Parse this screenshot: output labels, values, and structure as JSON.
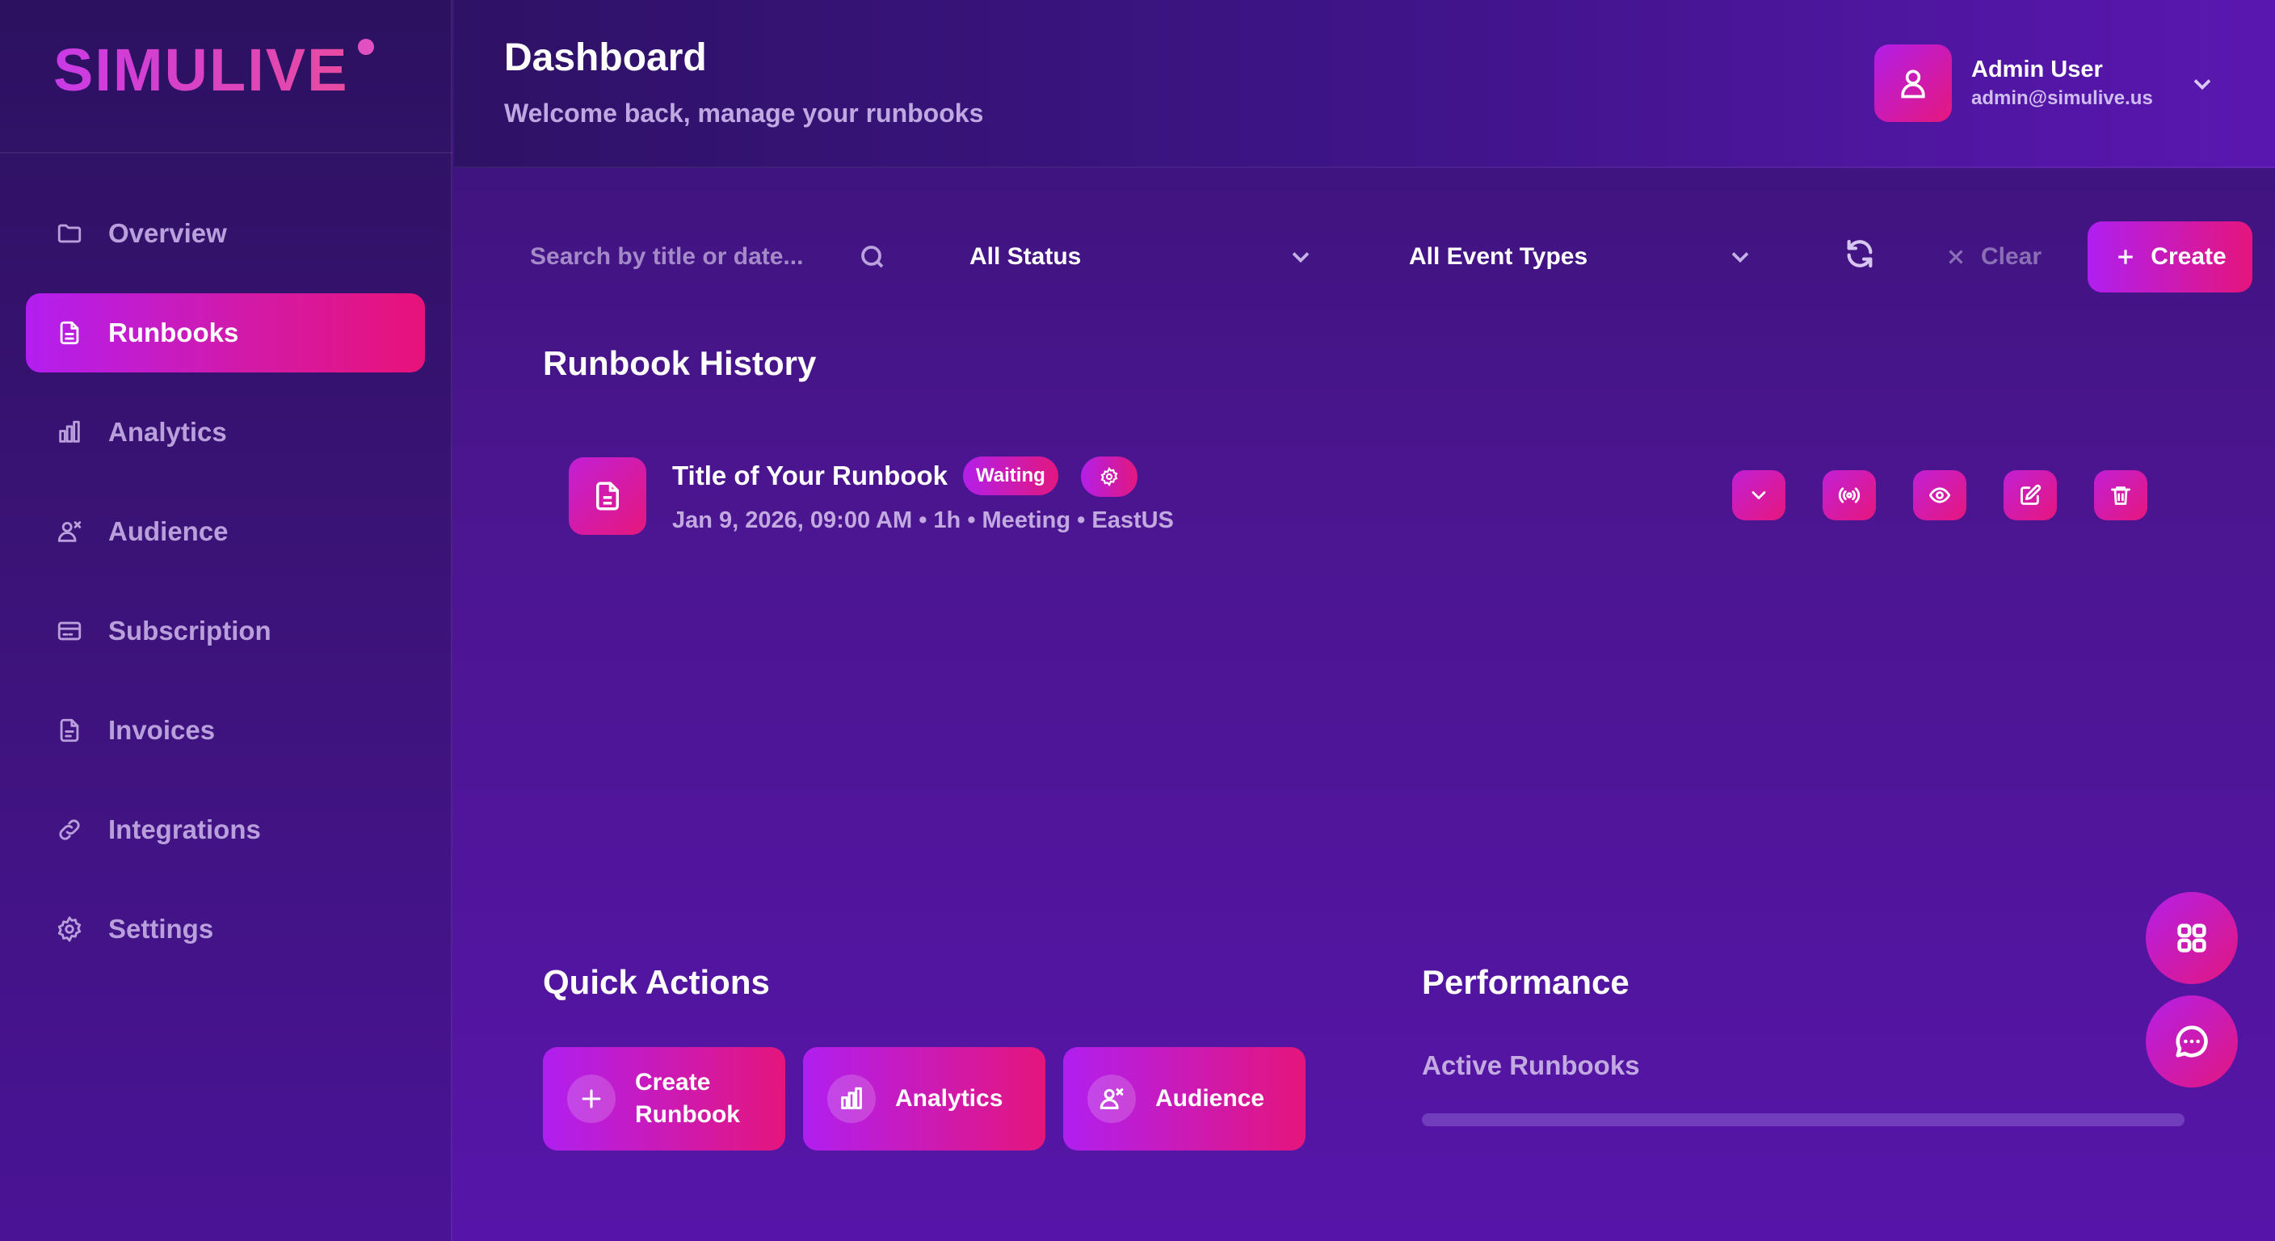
{
  "brand": {
    "name": "SIMULIVE"
  },
  "sidebar": {
    "items": [
      {
        "label": "Overview",
        "icon": "folder-icon",
        "active": false
      },
      {
        "label": "Runbooks",
        "icon": "file-icon",
        "active": true
      },
      {
        "label": "Analytics",
        "icon": "bar-chart-icon",
        "active": false
      },
      {
        "label": "Audience",
        "icon": "audience-icon",
        "active": false
      },
      {
        "label": "Subscription",
        "icon": "credit-card-icon",
        "active": false
      },
      {
        "label": "Invoices",
        "icon": "invoice-icon",
        "active": false
      },
      {
        "label": "Integrations",
        "icon": "link-icon",
        "active": false
      },
      {
        "label": "Settings",
        "icon": "gear-icon",
        "active": false
      }
    ]
  },
  "header": {
    "title": "Dashboard",
    "subtitle": "Welcome back, manage your runbooks",
    "user": {
      "name": "Admin User",
      "email": "admin@simulive.us"
    }
  },
  "toolbar": {
    "search_placeholder": "Search by title or date...",
    "status_selected": "All Status",
    "type_selected": "All Event Types",
    "clear_label": "Clear",
    "create_label": "Create"
  },
  "runbook_history": {
    "title": "Runbook History",
    "items": [
      {
        "title": "Title of Your Runbook",
        "status": "Waiting",
        "meta": "Jan 9, 2026, 09:00 AM • 1h • Meeting • EastUS"
      }
    ]
  },
  "quick_actions": {
    "title": "Quick Actions",
    "items": [
      {
        "label": "Create Runbook",
        "icon": "plus-icon"
      },
      {
        "label": "Analytics",
        "icon": "bar-chart-icon"
      },
      {
        "label": "Audience",
        "icon": "audience-icon"
      }
    ]
  },
  "performance": {
    "title": "Performance",
    "active_runbooks_label": "Active Runbooks",
    "active_runbooks_fraction": 0
  },
  "colors": {
    "accent_start": "#b01ff0",
    "accent_end": "#e5157c",
    "background": "#4b1590",
    "muted_text": "#c2aae0"
  }
}
